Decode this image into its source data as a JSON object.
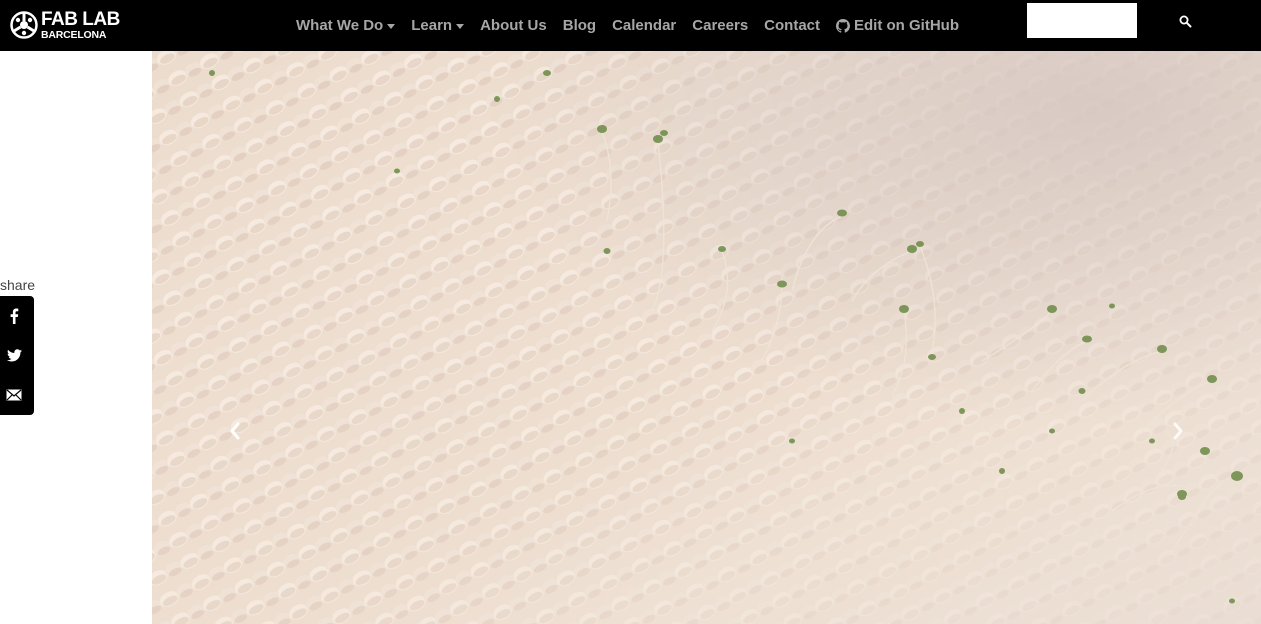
{
  "brand": {
    "line1": "FAB LAB",
    "line2": "BARCELONA",
    "icon": "fablab-logo-icon"
  },
  "nav": {
    "items": [
      {
        "label": "What We Do",
        "dropdown": true
      },
      {
        "label": "Learn",
        "dropdown": true
      },
      {
        "label": "About Us",
        "dropdown": false
      },
      {
        "label": "Blog",
        "dropdown": false
      },
      {
        "label": "Calendar",
        "dropdown": false
      },
      {
        "label": "Careers",
        "dropdown": false
      },
      {
        "label": "Contact",
        "dropdown": false
      },
      {
        "label": "Edit on GitHub",
        "dropdown": false,
        "icon": "github-icon"
      }
    ],
    "search_value": "",
    "search_icon": "search-icon"
  },
  "share": {
    "label": "share",
    "buttons": [
      {
        "name": "facebook",
        "icon": "facebook-icon"
      },
      {
        "name": "twitter",
        "icon": "twitter-icon"
      },
      {
        "name": "email",
        "icon": "email-icon"
      }
    ]
  },
  "carousel": {
    "prev_icon": "chevron-left-icon",
    "next_icon": "chevron-right-icon"
  },
  "colors": {
    "navbar_bg": "#000000",
    "nav_text": "#a6a6a6",
    "share_bg": "#000000"
  }
}
